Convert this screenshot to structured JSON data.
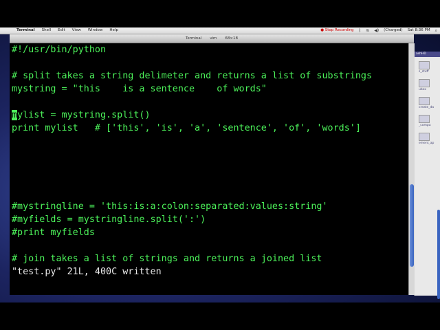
{
  "menubar": {
    "apple_glyph": "",
    "items": [
      "Terminal",
      "Shell",
      "Edit",
      "View",
      "Window",
      "Help"
    ],
    "status": {
      "recording": "Stop Recording",
      "clock": "Sat 8:36 PM",
      "charge": "(Charged)"
    }
  },
  "window": {
    "title_app": "Terminal",
    "title_proc": "vim",
    "title_size": "68×18"
  },
  "editor": {
    "lines": [
      "#!/usr/bin/python",
      "",
      "# split takes a string delimeter and returns a list of substrings",
      "mystring = \"this    is a sentence    of words\"",
      "",
      "",
      "print mylist   # ['this', 'is', 'a', 'sentence', 'of', 'words']",
      "",
      "",
      "",
      "",
      "",
      "#mystringline = 'this:is:a:colon:separated:values:string'",
      "#myfields = mystringline.split(':')",
      "#print myfields",
      "",
      "# join takes a list of strings and returns a joined list"
    ],
    "cursor_char": "m",
    "cursor_rest": "ylist = mystring.split()",
    "status_line": "\"test.py\" 21L, 400C written"
  },
  "desktop": {
    "header": "ashHD",
    "items": [
      "s_stuff",
      "ubox",
      "create_da",
      "_compu",
      "ement_ap"
    ]
  },
  "colors": {
    "terminal_text": "#4cf25a",
    "terminal_bg": "#000000"
  }
}
